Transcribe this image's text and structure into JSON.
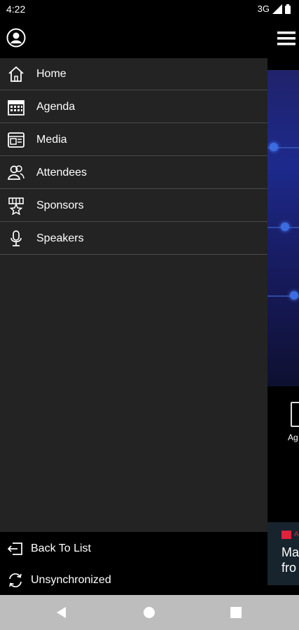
{
  "status_bar": {
    "time": "4:22",
    "network": "3G"
  },
  "drawer": {
    "items": [
      {
        "label": "Home",
        "icon": "home-icon"
      },
      {
        "label": "Agenda",
        "icon": "calendar-icon"
      },
      {
        "label": "Media",
        "icon": "media-icon"
      },
      {
        "label": "Attendees",
        "icon": "attendees-icon"
      },
      {
        "label": "Sponsors",
        "icon": "sponsors-icon"
      },
      {
        "label": "Speakers",
        "icon": "microphone-icon"
      }
    ],
    "footer": [
      {
        "label": "Back To List",
        "icon": "back-to-list-icon"
      },
      {
        "label": "Unsynchronized",
        "icon": "sync-icon"
      }
    ]
  },
  "background": {
    "agenda_label": "Ag",
    "card_badge": "A",
    "card_text": "Ma\nfro"
  },
  "colors": {
    "drawer_bg": "#232323",
    "divider": "#4a4a4a",
    "hero": "#1d2a8c",
    "accent_red": "#e0223a"
  }
}
